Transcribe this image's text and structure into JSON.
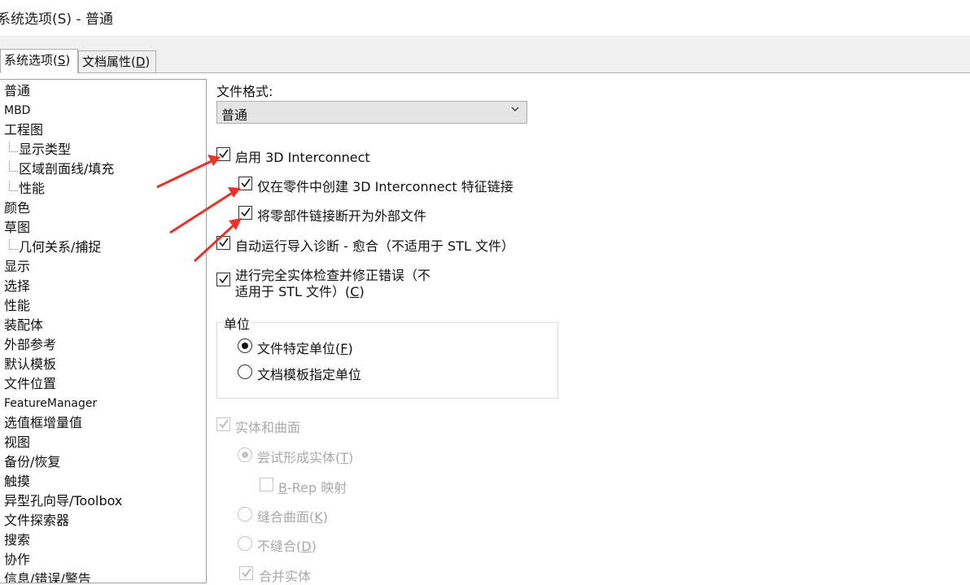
{
  "window": {
    "title": "系统选项(S) - 普通"
  },
  "tabs": [
    {
      "label": "系统选项(",
      "mnemonic": "S",
      "suffix": ")"
    },
    {
      "label": "文档属性(",
      "mnemonic": "D",
      "suffix": ")"
    }
  ],
  "tree": {
    "items": [
      {
        "label": "普通"
      },
      {
        "label": "MBD"
      },
      {
        "label": "工程图"
      },
      {
        "label": "显示类型"
      },
      {
        "label": "区域剖面线/填充"
      },
      {
        "label": "性能"
      },
      {
        "label": "颜色"
      },
      {
        "label": "草图"
      },
      {
        "label": "几何关系/捕捉"
      },
      {
        "label": "显示"
      },
      {
        "label": "选择"
      },
      {
        "label": "性能"
      },
      {
        "label": "装配体"
      },
      {
        "label": "外部参考"
      },
      {
        "label": "默认模板"
      },
      {
        "label": "文件位置"
      },
      {
        "label": "FeatureManager"
      },
      {
        "label": "选值框增量值"
      },
      {
        "label": "视图"
      },
      {
        "label": "备份/恢复"
      },
      {
        "label": "触摸"
      },
      {
        "label": "异型孔向导/Toolbox"
      },
      {
        "label": "文件探索器"
      },
      {
        "label": "搜索"
      },
      {
        "label": "协作"
      },
      {
        "label": "信息/错误/警告"
      }
    ]
  },
  "panel": {
    "file_format_label": "文件格式:",
    "file_format_value": "普通",
    "options": {
      "enable_3d_interconnect": {
        "label": "启用 3D Interconnect",
        "checked": true
      },
      "create_links_in_parts": {
        "label": "仅在零件中创建 3D Interconnect 特征链接",
        "checked": true
      },
      "break_links": {
        "label": "将零部件链接断开为外部文件",
        "checked": true
      },
      "auto_diagnose": {
        "label": "自动运行导入诊断 - 愈合（不适用于 STL 文件）",
        "checked": true
      },
      "full_check_line1": "进行完全实体检查并修正错误（不",
      "full_check_line2_a": "适用于 STL 文件）(",
      "full_check_mnemonic": "C",
      "full_check_suffix": ")"
    },
    "units": {
      "title": "单位",
      "file_units": {
        "label": "文件特定单位(",
        "mnemonic": "F",
        "suffix": ")",
        "selected": true
      },
      "template_units": {
        "label": "文档模板指定单位",
        "selected": false
      }
    },
    "solids": {
      "label": "实体和曲面",
      "try_form_solid": {
        "label": "尝试形成实体(",
        "mnemonic": "T",
        "suffix": ")"
      },
      "brep_prefix": "B",
      "brep_rest": "-Rep 映射",
      "knit_surfaces": {
        "label": "缝合曲面(",
        "mnemonic": "K",
        "suffix": ")"
      },
      "no_knit": {
        "label": "不缝合(",
        "mnemonic": "D",
        "suffix": ")"
      },
      "merge_solids": "合并实体"
    }
  },
  "colors": {
    "annotation_arrow": "#e8332a",
    "disabled": "#a8a8a8"
  }
}
